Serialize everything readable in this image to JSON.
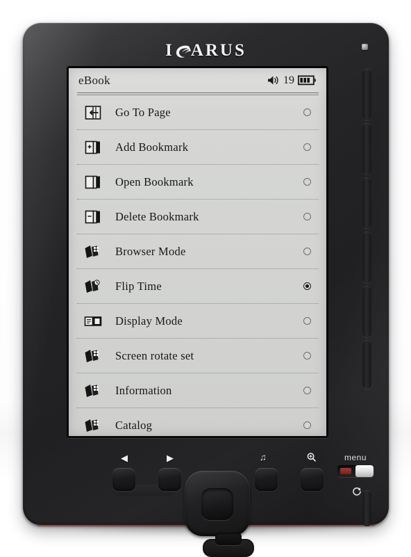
{
  "device": {
    "brand": "ICARUS",
    "brand_wing_icon": "wing-icon",
    "led_icon": "status-led-icon"
  },
  "screen": {
    "header": {
      "title": "eBook",
      "speaker_icon": "speaker-icon",
      "volume": "19",
      "battery_icon": "battery-icon",
      "battery_bars": 3
    },
    "menu_items": [
      {
        "label": "Go To Page",
        "icon": "book-goto-page-icon",
        "selected": false
      },
      {
        "label": "Add Bookmark",
        "icon": "book-add-bookmark-icon",
        "selected": false
      },
      {
        "label": "Open Bookmark",
        "icon": "book-open-bookmark-icon",
        "selected": false
      },
      {
        "label": "Delete Bookmark",
        "icon": "book-delete-bookmark-icon",
        "selected": false
      },
      {
        "label": "Browser Mode",
        "icon": "browser-mode-icon",
        "selected": false
      },
      {
        "label": "Flip Time",
        "icon": "flip-time-icon",
        "selected": true
      },
      {
        "label": "Display Mode",
        "icon": "display-mode-icon",
        "selected": false
      },
      {
        "label": "Screen rotate set",
        "icon": "screen-rotate-icon",
        "selected": false
      },
      {
        "label": "Information",
        "icon": "information-icon",
        "selected": false
      },
      {
        "label": "Catalog",
        "icon": "catalog-icon",
        "selected": false
      }
    ]
  },
  "controls": {
    "prev_page_icon": "triangle-left-icon",
    "next_page_icon": "triangle-right-icon",
    "music_icon": "music-note-icon",
    "zoom_icon": "magnifier-icon",
    "dpad_icon": "dpad-icon",
    "menu_switch_label": "menu",
    "refresh_icon": "refresh-icon"
  },
  "colors": {
    "eink_background": "#d5d6d4",
    "eink_text": "#161616",
    "device_body": "#232325",
    "accent_red": "#8a2e26"
  }
}
